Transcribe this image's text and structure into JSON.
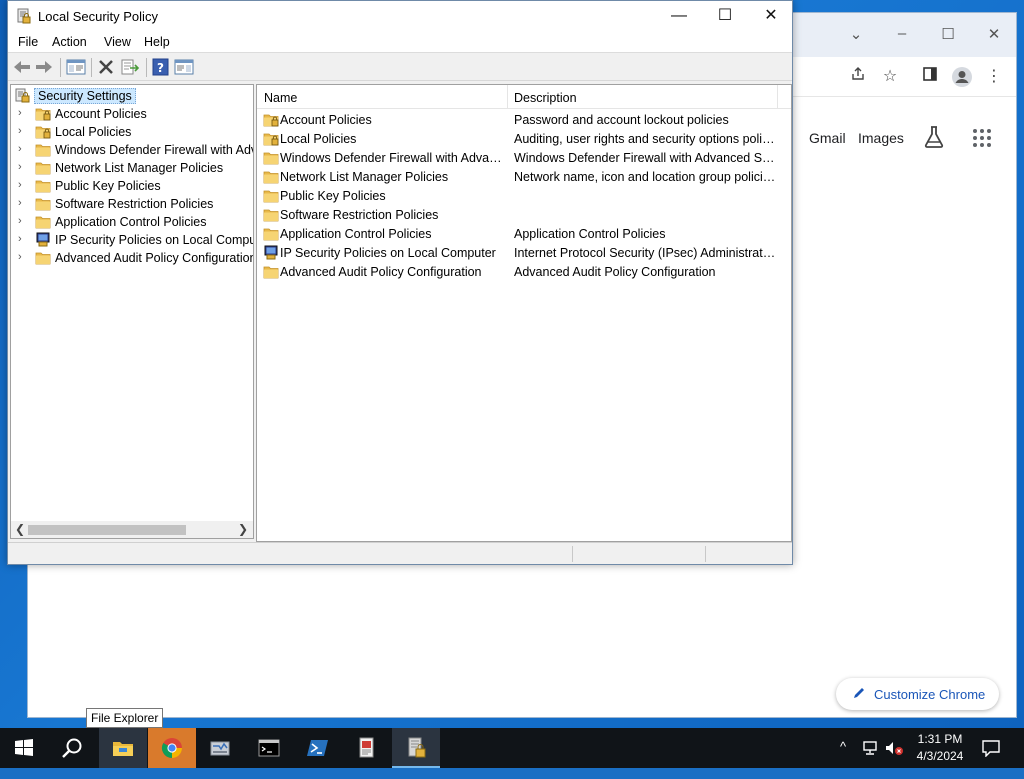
{
  "window": {
    "title": "Local Security Policy",
    "controls": {
      "minimize": "—",
      "maximize": "☐",
      "close": "✕"
    }
  },
  "menu": [
    "File",
    "Action",
    "View",
    "Help"
  ],
  "tree": {
    "root": "Security Settings",
    "items": [
      {
        "label": "Account Policies",
        "icon": "policy-folder-icon"
      },
      {
        "label": "Local Policies",
        "icon": "policy-folder-icon"
      },
      {
        "label": "Windows Defender Firewall with Adva",
        "icon": "folder-icon"
      },
      {
        "label": "Network List Manager Policies",
        "icon": "folder-icon"
      },
      {
        "label": "Public Key Policies",
        "icon": "folder-icon"
      },
      {
        "label": "Software Restriction Policies",
        "icon": "folder-icon"
      },
      {
        "label": "Application Control Policies",
        "icon": "folder-icon"
      },
      {
        "label": "IP Security Policies on Local Compute",
        "icon": "ipsec-icon"
      },
      {
        "label": "Advanced Audit Policy Configuration",
        "icon": "folder-icon"
      }
    ]
  },
  "list": {
    "columns": [
      "Name",
      "Description"
    ],
    "rows": [
      {
        "name": "Account Policies",
        "description": "Password and account lockout policies",
        "icon": "policy-folder-icon"
      },
      {
        "name": "Local Policies",
        "description": "Auditing, user rights and security options polici...",
        "icon": "policy-folder-icon"
      },
      {
        "name": "Windows Defender Firewall with Advanc...",
        "description": "Windows Defender Firewall with Advanced Sec...",
        "icon": "folder-icon"
      },
      {
        "name": "Network List Manager Policies",
        "description": "Network name, icon and location group policies.",
        "icon": "folder-icon"
      },
      {
        "name": "Public Key Policies",
        "description": "",
        "icon": "folder-icon"
      },
      {
        "name": "Software Restriction Policies",
        "description": "",
        "icon": "folder-icon"
      },
      {
        "name": "Application Control Policies",
        "description": "Application Control Policies",
        "icon": "folder-icon"
      },
      {
        "name": "IP Security Policies on Local Computer",
        "description": "Internet Protocol Security (IPsec) Administratio...",
        "icon": "ipsec-icon"
      },
      {
        "name": "Advanced Audit Policy Configuration",
        "description": "Advanced Audit Policy Configuration",
        "icon": "folder-icon"
      }
    ]
  },
  "chrome": {
    "links": {
      "gmail": "Gmail",
      "images": "Images"
    },
    "customize": "Customize Chrome"
  },
  "tooltip": "File Explorer",
  "taskbar": {
    "clock_time": "1:31 PM",
    "clock_date": "4/3/2024"
  },
  "colors": {
    "selection": "#cce8ff",
    "folder": "#f3c95b",
    "desktop": "#1877d2",
    "taskbar": "#101418"
  }
}
